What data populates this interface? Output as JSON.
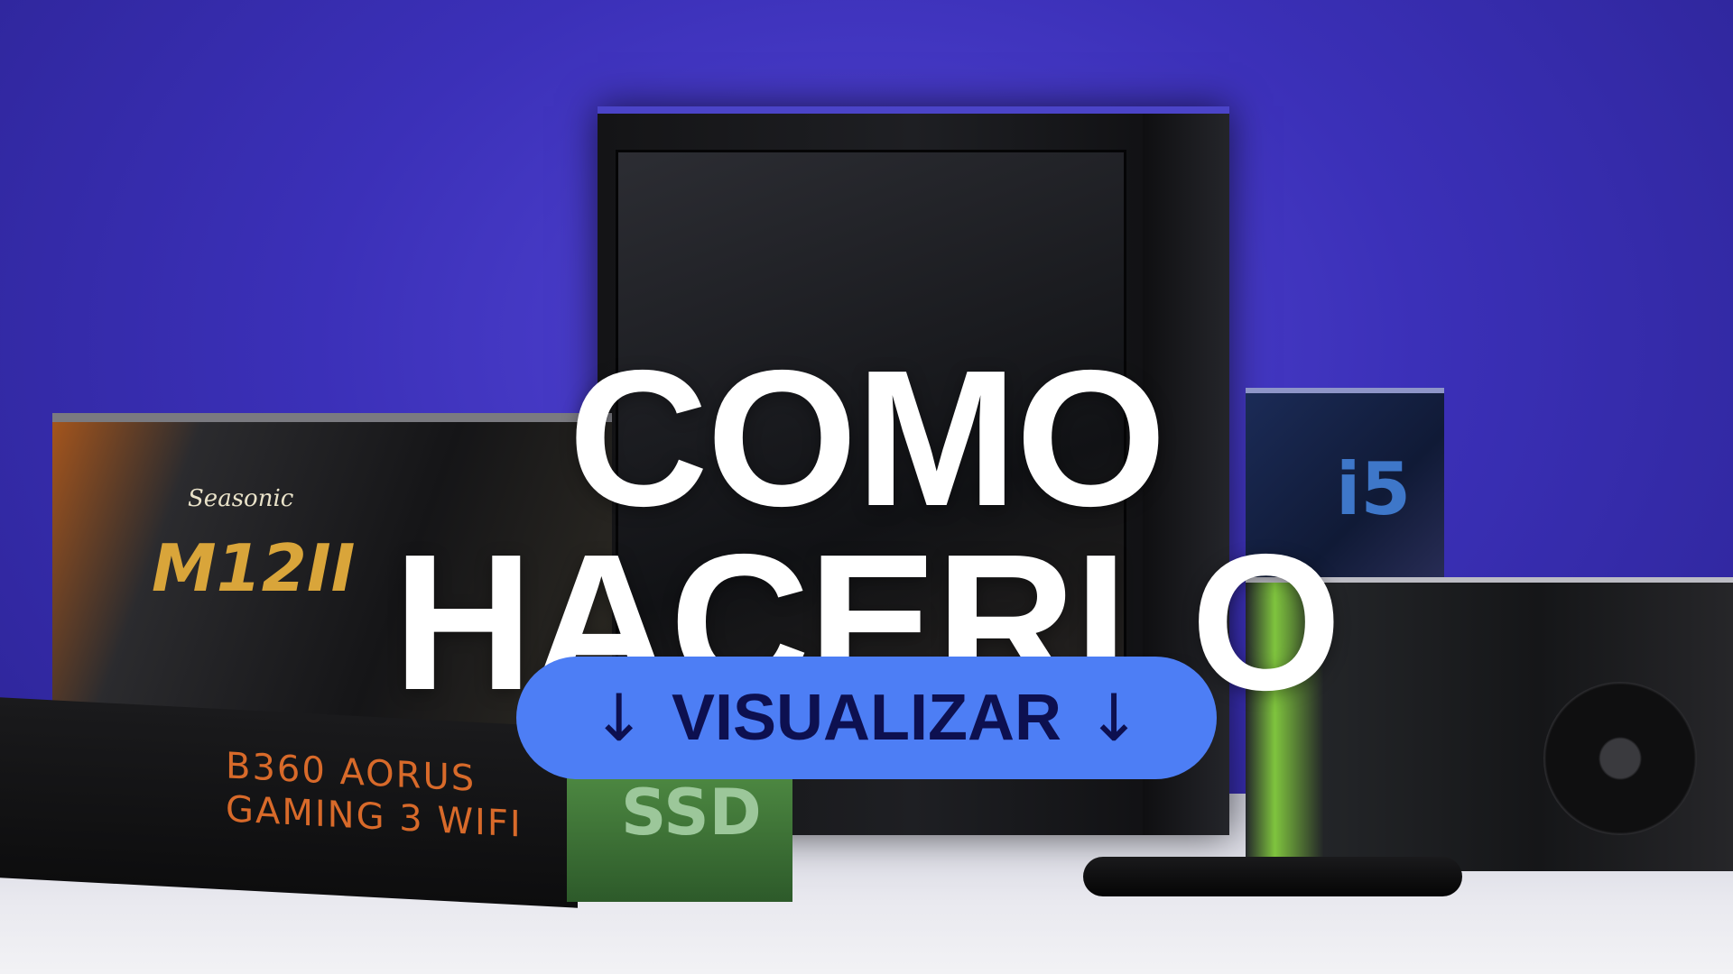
{
  "headline": {
    "line1": "COMO",
    "line2": "HACERLO"
  },
  "cta": {
    "left_arrow": "↓",
    "label": "VISUALIZAR",
    "right_arrow": "↓",
    "color": "#4d7ef5"
  },
  "background": {
    "psu_brand": "Seasonic",
    "psu_model": "M12II",
    "mobo_line1": "B360 AORUS",
    "mobo_line2": "GAMING 3 WIFI",
    "cpu_text": "i5",
    "ssd_text": "SSD",
    "accent": "#3b30b8"
  }
}
